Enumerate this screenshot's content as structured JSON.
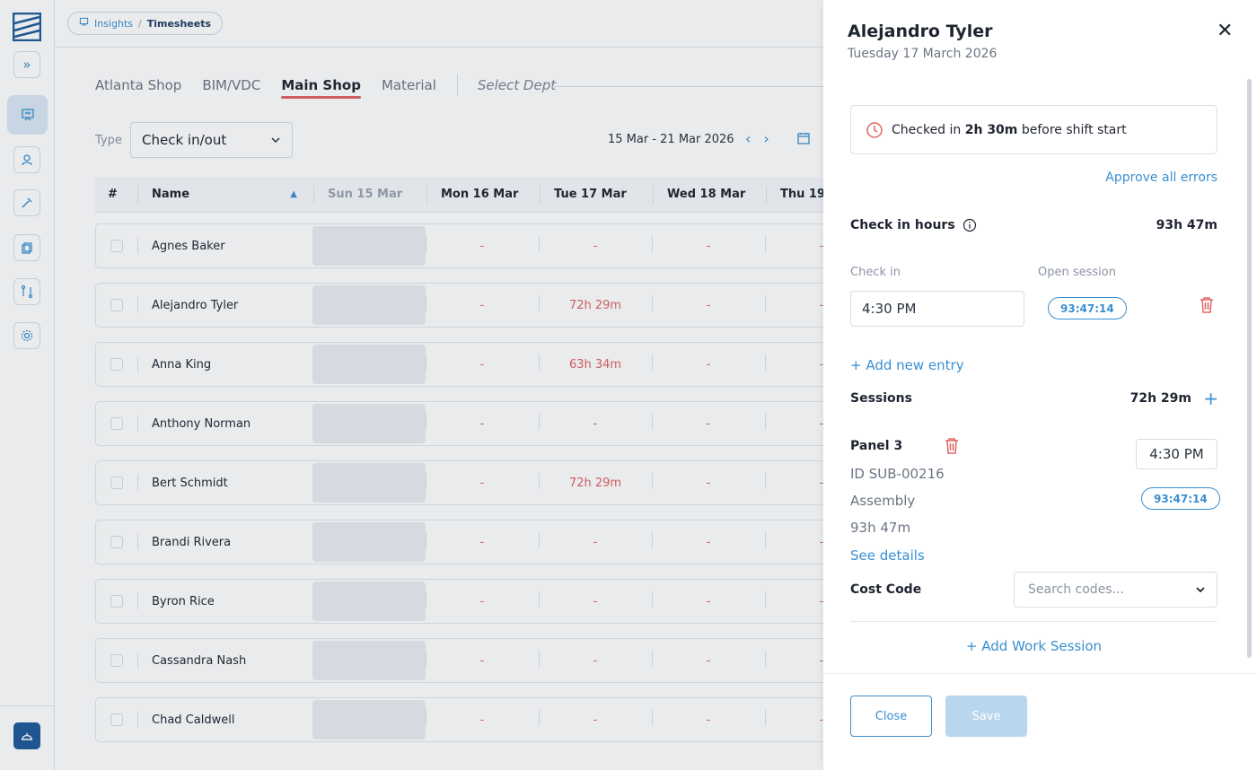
{
  "breadcrumb": {
    "section": "Insights",
    "separator": "/",
    "page": "Timesheets"
  },
  "tabs": [
    {
      "label": "Atlanta Shop",
      "active": false
    },
    {
      "label": "BIM/VDC",
      "active": false
    },
    {
      "label": "Main Shop",
      "active": true
    },
    {
      "label": "Material",
      "active": false
    }
  ],
  "select_dept": "Select Dept",
  "filters": {
    "type_label": "Type",
    "type_value": "Check in/out",
    "date_range": "15 Mar - 21 Mar 2026"
  },
  "table": {
    "columns": [
      "#",
      "Name",
      "Sun 15 Mar",
      "Mon 16 Mar",
      "Tue 17 Mar",
      "Wed 18 Mar",
      "Thu 19"
    ],
    "rows": [
      {
        "name": "Agnes Baker",
        "mon": "-",
        "tue": "-",
        "wed": "-",
        "thu": "-"
      },
      {
        "name": "Alejandro Tyler",
        "mon": "-",
        "tue": "72h 29m",
        "wed": "-",
        "thu": "-"
      },
      {
        "name": "Anna King",
        "mon": "-",
        "tue": "63h 34m",
        "wed": "-",
        "thu": "-"
      },
      {
        "name": "Anthony Norman",
        "mon": "-",
        "tue": "-",
        "wed": "-",
        "thu": "-"
      },
      {
        "name": "Bert Schmidt",
        "mon": "-",
        "tue": "72h 29m",
        "wed": "-",
        "thu": "-"
      },
      {
        "name": "Brandi Rivera",
        "mon": "-",
        "tue": "-",
        "wed": "-",
        "thu": "-"
      },
      {
        "name": "Byron Rice",
        "mon": "-",
        "tue": "-",
        "wed": "-",
        "thu": "-"
      },
      {
        "name": "Cassandra Nash",
        "mon": "-",
        "tue": "-",
        "wed": "-",
        "thu": "-"
      },
      {
        "name": "Chad Caldwell",
        "mon": "-",
        "tue": "-",
        "wed": "-",
        "thu": "-"
      }
    ]
  },
  "panel": {
    "name": "Alejandro Tyler",
    "date": "Tuesday 17 March 2026",
    "alert_prefix": "Checked in ",
    "alert_bold": "2h 30m",
    "alert_suffix": " before shift start",
    "approve_all": "Approve all errors",
    "check_in_hours_label": "Check in hours",
    "check_in_hours_value": "93h 47m",
    "check_in_label": "Check in",
    "open_session_label": "Open session",
    "check_in_value": "4:30 PM",
    "open_session_value": "93:47:14",
    "add_entry": "+ Add new entry",
    "sessions_label": "Sessions",
    "sessions_value": "72h 29m",
    "session": {
      "title": "Panel 3",
      "id": "ID SUB-00216",
      "type": "Assembly",
      "duration": "93h 47m",
      "see_details": "See details",
      "time": "4:30 PM",
      "timer": "93:47:14"
    },
    "cost_code_label": "Cost Code",
    "cost_code_placeholder": "Search codes...",
    "add_work_session": "+ Add Work Session",
    "close_btn": "Close",
    "save_btn": "Save"
  },
  "colors": {
    "accent": "#3a8fd0",
    "error": "#e06363",
    "brand": "#1f5a9a"
  }
}
